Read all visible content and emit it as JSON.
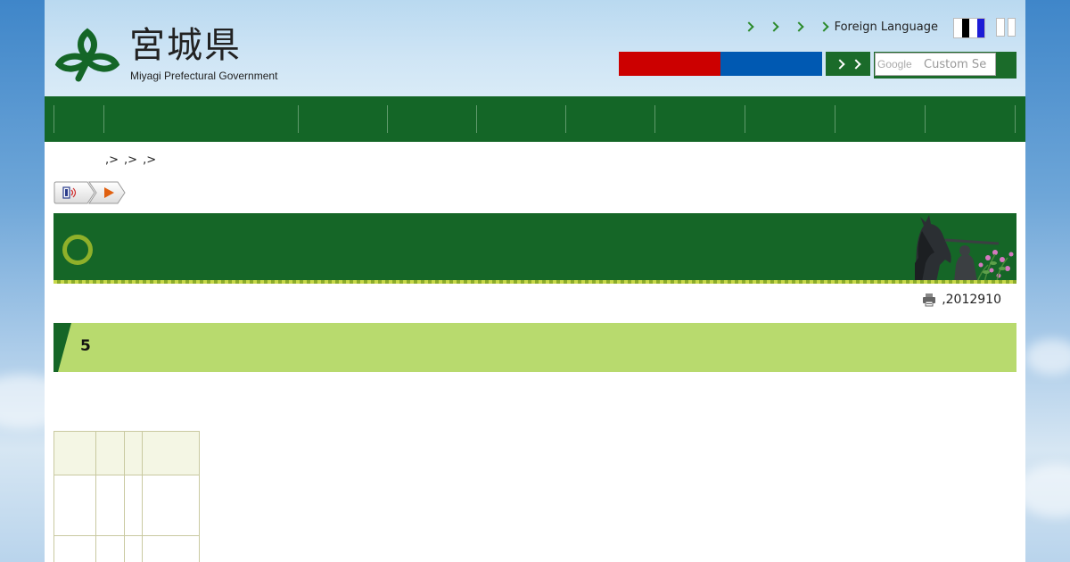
{
  "header": {
    "site_name": "宮城県",
    "site_subtitle": "Miyagi Prefectural Government",
    "top_links": [
      "",
      "",
      "",
      "Foreign Language"
    ],
    "search": {
      "placeholder": "Custom Se",
      "watermark": "Google"
    }
  },
  "nav": {
    "items": [
      "",
      "",
      "",
      "",
      "",
      "",
      "",
      "",
      "",
      "",
      ""
    ]
  },
  "breadcrumb": [
    ",>",
    ",>",
    ",>"
  ],
  "banner": {
    "title": ""
  },
  "print": {
    "text": ",2012910"
  },
  "section": {
    "heading": "5"
  },
  "colors": {
    "header_green": "#146627",
    "accent_red": "#cc0000",
    "accent_blue": "#0059b2",
    "section_light_green": "#b8da6e",
    "ring_olive": "#8fb02a"
  }
}
